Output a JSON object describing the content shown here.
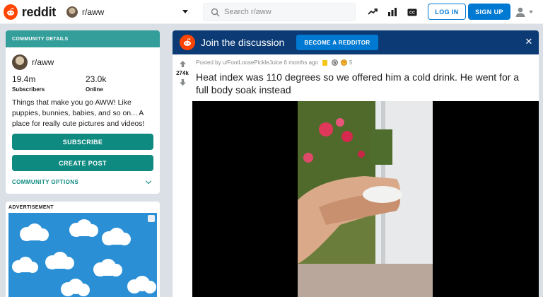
{
  "header": {
    "brand": "reddit",
    "community": "r/aww",
    "search_placeholder": "Search r/aww",
    "login_label": "LOG IN",
    "signup_label": "SIGN UP",
    "icons": [
      "reddit-logo-icon",
      "trending-icon",
      "chart-icon",
      "closed-caption-icon",
      "user-icon"
    ]
  },
  "sidebar": {
    "heading": "COMMUNITY DETAILS",
    "community_name": "r/aww",
    "members_value": "19.4m",
    "members_label": "Subscribers",
    "online_value": "23.0k",
    "online_label": "Online",
    "description": "Things that make you go AWW! Like puppies, bunnies, babies, and so on... A place for really cute pictures and videos!",
    "subscribe_label": "SUBSCRIBE",
    "create_post_label": "CREATE POST",
    "options_label": "COMMUNITY OPTIONS"
  },
  "ad": {
    "label": "ADVERTISEMENT"
  },
  "banner": {
    "title": "Join the discussion",
    "cta_label": "BECOME A REDDITOR",
    "close_glyph": "✕"
  },
  "post": {
    "votes": "274k",
    "meta": "Posted by u/FootLoosePickleJuice 6 months ago",
    "award_count": "5",
    "title": "Heat index was 110 degrees so we offered him a cold drink. He went for a full body soak instead"
  },
  "colors": {
    "brand": "#ff4500",
    "primary_blue": "#0079d3",
    "community_teal": "#0e8a80",
    "banner_navy": "#0b3a75"
  }
}
